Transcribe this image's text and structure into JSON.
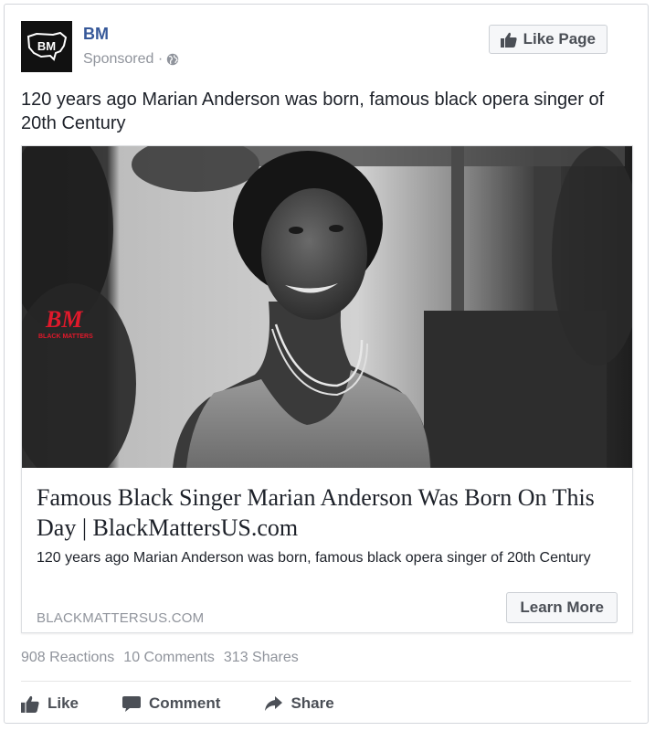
{
  "post": {
    "page_name": "BM",
    "avatar_text": "BM",
    "sponsored_label": "Sponsored · ",
    "like_page_label": "Like Page",
    "message": "120 years ago Marian Anderson was born, famous black opera singer of 20th Century"
  },
  "link": {
    "image_logo_text": "BM",
    "image_logo_subtext": "BLACK MATTERS",
    "title": "Famous Black Singer Marian Anderson Was Born On This Day | BlackMattersUS.com",
    "description": "120 years ago Marian Anderson was born, famous black opera singer of 20th Century",
    "domain": "BLACKMATTERSUS.COM",
    "cta_label": "Learn More"
  },
  "stats": {
    "reactions": "908 Reactions",
    "comments": "10 Comments",
    "shares": "313 Shares"
  },
  "actions": {
    "like": "Like",
    "comment": "Comment",
    "share": "Share"
  },
  "icons": {
    "globe": "globe-icon",
    "thumbs_up": "thumbs-up-icon",
    "comment": "comment-icon",
    "share": "share-arrow-icon"
  },
  "colors": {
    "page_name": "#365899",
    "muted_text": "#90949c",
    "button_text": "#4b4f56",
    "logo_red": "#e0192b"
  }
}
